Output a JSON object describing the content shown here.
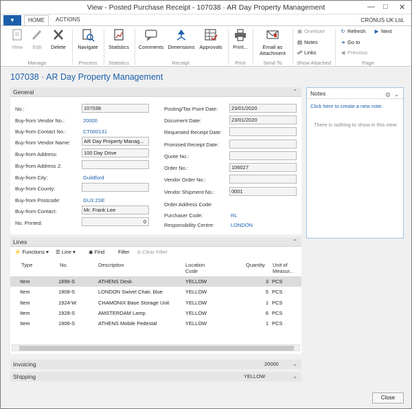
{
  "window": {
    "title": "View - Posted Purchase Receipt - 107038 · AR Day Property Management"
  },
  "tabs": {
    "home": "HOME",
    "actions": "ACTIONS"
  },
  "company": "CRONUS UK Ltd.",
  "ribbon": {
    "view": "View",
    "edit": "Edit",
    "delete": "Delete",
    "navigate": "Navigate",
    "statistics": "Statistics",
    "comments": "Comments",
    "dimensions": "Dimensions",
    "approvals": "Approvals",
    "print": "Print...",
    "email_line1": "Email as",
    "email_line2": "Attachment",
    "onenote": "OneNote",
    "notes": "Notes",
    "links": "Links",
    "refresh": "Refresh",
    "next": "Next",
    "goto": "Go to",
    "previous": "Previous",
    "groups": {
      "manage": "Manage",
      "process": "Process",
      "statistics": "Statistics",
      "receipt": "Receipt",
      "print": "Print",
      "sendto": "Send To",
      "show_attached": "Show Attached",
      "page": "Page"
    }
  },
  "page_title": "107038 · AR Day Property Management",
  "general": {
    "header": "General",
    "left": [
      {
        "label": "No.:",
        "value": "107038"
      },
      {
        "label": "Buy-from Vendor No.:",
        "value": "20000"
      },
      {
        "label": "Buy-from Contact No.:",
        "value": "CT000131"
      },
      {
        "label": "Buy-from Vendor Name:",
        "value": "AR Day Property Manag..."
      },
      {
        "label": "Buy-from Address:",
        "value": "100 Day Drive"
      },
      {
        "label": "Buy-from Address 2:",
        "value": ""
      },
      {
        "label": "Buy-from City:",
        "value": "Guildford"
      },
      {
        "label": "Buy-from County:",
        "value": ""
      },
      {
        "label": "Buy-from Postcode:",
        "value": "GU3 2SE"
      },
      {
        "label": "Buy-from Contact:",
        "value": "Mr. Frank Lee"
      },
      {
        "label": "No. Printed:",
        "value": "0"
      }
    ],
    "right": [
      {
        "label": "Posting/Tax Point Date:",
        "value": "23/01/2020"
      },
      {
        "label": "Document Date:",
        "value": "23/01/2020"
      },
      {
        "label": "Requested Receipt Date:",
        "value": ""
      },
      {
        "label": "Promised Receipt Date:",
        "value": ""
      },
      {
        "label": "Quote No.:",
        "value": ""
      },
      {
        "label": "Order No.:",
        "value": "106027"
      },
      {
        "label": "Vendor Order No.:",
        "value": ""
      },
      {
        "label": "Vendor Shipment No.:",
        "value": "0001"
      },
      {
        "label": "Order Address Code:",
        "value": ""
      },
      {
        "label": "Purchaser Code:",
        "value": "RL"
      },
      {
        "label": "Responsibility Centre:",
        "value": "LONDON"
      }
    ]
  },
  "notes": {
    "header": "Notes",
    "create_link": "Click here to create a new note.",
    "empty": "There is nothing to show in this view."
  },
  "lines": {
    "header": "Lines",
    "toolbar": {
      "functions": "Functions",
      "line": "Line",
      "find": "Find",
      "filter": "Filter",
      "clear_filter": "Clear Filter"
    },
    "columns": {
      "type": "Type",
      "no": "No.",
      "description": "Description",
      "location_1": "Location",
      "location_2": "Code",
      "quantity": "Quantity",
      "uom_1": "Unit of",
      "uom_2": "Measur..."
    },
    "rows": [
      {
        "type": "Item",
        "no": "1896-S",
        "description": "ATHENS Desk",
        "location": "YELLOW",
        "quantity": "3",
        "uom": "PCS"
      },
      {
        "type": "Item",
        "no": "1908-S",
        "description": "LONDON Swivel Chair, blue",
        "location": "YELLOW",
        "quantity": "5",
        "uom": "PCS"
      },
      {
        "type": "Item",
        "no": "1924-W",
        "description": "CHAMONIX Base Storage Unit",
        "location": "YELLOW",
        "quantity": "1",
        "uom": "PCS"
      },
      {
        "type": "Item",
        "no": "1928-S",
        "description": "AMSTERDAM Lamp",
        "location": "YELLOW",
        "quantity": "6",
        "uom": "PCS"
      },
      {
        "type": "Item",
        "no": "1906-S",
        "description": "ATHENS Mobile Pedestal",
        "location": "YELLOW",
        "quantity": "1",
        "uom": "PCS"
      }
    ]
  },
  "invoicing": {
    "label": "Invoicing",
    "summary": "20000"
  },
  "shipping": {
    "label": "Shipping",
    "summary": "YELLOW"
  },
  "close": "Close"
}
